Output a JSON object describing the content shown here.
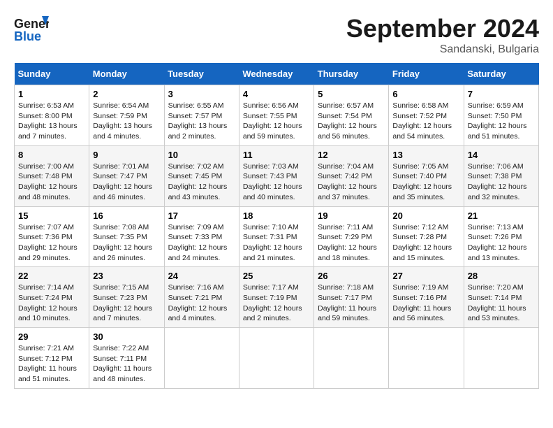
{
  "header": {
    "logo_general": "General",
    "logo_blue": "Blue",
    "month_title": "September 2024",
    "location": "Sandanski, Bulgaria"
  },
  "days_of_week": [
    "Sunday",
    "Monday",
    "Tuesday",
    "Wednesday",
    "Thursday",
    "Friday",
    "Saturday"
  ],
  "weeks": [
    [
      {
        "day": "1",
        "sunrise": "Sunrise: 6:53 AM",
        "sunset": "Sunset: 8:00 PM",
        "daylight": "Daylight: 13 hours and 7 minutes."
      },
      {
        "day": "2",
        "sunrise": "Sunrise: 6:54 AM",
        "sunset": "Sunset: 7:59 PM",
        "daylight": "Daylight: 13 hours and 4 minutes."
      },
      {
        "day": "3",
        "sunrise": "Sunrise: 6:55 AM",
        "sunset": "Sunset: 7:57 PM",
        "daylight": "Daylight: 13 hours and 2 minutes."
      },
      {
        "day": "4",
        "sunrise": "Sunrise: 6:56 AM",
        "sunset": "Sunset: 7:55 PM",
        "daylight": "Daylight: 12 hours and 59 minutes."
      },
      {
        "day": "5",
        "sunrise": "Sunrise: 6:57 AM",
        "sunset": "Sunset: 7:54 PM",
        "daylight": "Daylight: 12 hours and 56 minutes."
      },
      {
        "day": "6",
        "sunrise": "Sunrise: 6:58 AM",
        "sunset": "Sunset: 7:52 PM",
        "daylight": "Daylight: 12 hours and 54 minutes."
      },
      {
        "day": "7",
        "sunrise": "Sunrise: 6:59 AM",
        "sunset": "Sunset: 7:50 PM",
        "daylight": "Daylight: 12 hours and 51 minutes."
      }
    ],
    [
      {
        "day": "8",
        "sunrise": "Sunrise: 7:00 AM",
        "sunset": "Sunset: 7:48 PM",
        "daylight": "Daylight: 12 hours and 48 minutes."
      },
      {
        "day": "9",
        "sunrise": "Sunrise: 7:01 AM",
        "sunset": "Sunset: 7:47 PM",
        "daylight": "Daylight: 12 hours and 46 minutes."
      },
      {
        "day": "10",
        "sunrise": "Sunrise: 7:02 AM",
        "sunset": "Sunset: 7:45 PM",
        "daylight": "Daylight: 12 hours and 43 minutes."
      },
      {
        "day": "11",
        "sunrise": "Sunrise: 7:03 AM",
        "sunset": "Sunset: 7:43 PM",
        "daylight": "Daylight: 12 hours and 40 minutes."
      },
      {
        "day": "12",
        "sunrise": "Sunrise: 7:04 AM",
        "sunset": "Sunset: 7:42 PM",
        "daylight": "Daylight: 12 hours and 37 minutes."
      },
      {
        "day": "13",
        "sunrise": "Sunrise: 7:05 AM",
        "sunset": "Sunset: 7:40 PM",
        "daylight": "Daylight: 12 hours and 35 minutes."
      },
      {
        "day": "14",
        "sunrise": "Sunrise: 7:06 AM",
        "sunset": "Sunset: 7:38 PM",
        "daylight": "Daylight: 12 hours and 32 minutes."
      }
    ],
    [
      {
        "day": "15",
        "sunrise": "Sunrise: 7:07 AM",
        "sunset": "Sunset: 7:36 PM",
        "daylight": "Daylight: 12 hours and 29 minutes."
      },
      {
        "day": "16",
        "sunrise": "Sunrise: 7:08 AM",
        "sunset": "Sunset: 7:35 PM",
        "daylight": "Daylight: 12 hours and 26 minutes."
      },
      {
        "day": "17",
        "sunrise": "Sunrise: 7:09 AM",
        "sunset": "Sunset: 7:33 PM",
        "daylight": "Daylight: 12 hours and 24 minutes."
      },
      {
        "day": "18",
        "sunrise": "Sunrise: 7:10 AM",
        "sunset": "Sunset: 7:31 PM",
        "daylight": "Daylight: 12 hours and 21 minutes."
      },
      {
        "day": "19",
        "sunrise": "Sunrise: 7:11 AM",
        "sunset": "Sunset: 7:29 PM",
        "daylight": "Daylight: 12 hours and 18 minutes."
      },
      {
        "day": "20",
        "sunrise": "Sunrise: 7:12 AM",
        "sunset": "Sunset: 7:28 PM",
        "daylight": "Daylight: 12 hours and 15 minutes."
      },
      {
        "day": "21",
        "sunrise": "Sunrise: 7:13 AM",
        "sunset": "Sunset: 7:26 PM",
        "daylight": "Daylight: 12 hours and 13 minutes."
      }
    ],
    [
      {
        "day": "22",
        "sunrise": "Sunrise: 7:14 AM",
        "sunset": "Sunset: 7:24 PM",
        "daylight": "Daylight: 12 hours and 10 minutes."
      },
      {
        "day": "23",
        "sunrise": "Sunrise: 7:15 AM",
        "sunset": "Sunset: 7:23 PM",
        "daylight": "Daylight: 12 hours and 7 minutes."
      },
      {
        "day": "24",
        "sunrise": "Sunrise: 7:16 AM",
        "sunset": "Sunset: 7:21 PM",
        "daylight": "Daylight: 12 hours and 4 minutes."
      },
      {
        "day": "25",
        "sunrise": "Sunrise: 7:17 AM",
        "sunset": "Sunset: 7:19 PM",
        "daylight": "Daylight: 12 hours and 2 minutes."
      },
      {
        "day": "26",
        "sunrise": "Sunrise: 7:18 AM",
        "sunset": "Sunset: 7:17 PM",
        "daylight": "Daylight: 11 hours and 59 minutes."
      },
      {
        "day": "27",
        "sunrise": "Sunrise: 7:19 AM",
        "sunset": "Sunset: 7:16 PM",
        "daylight": "Daylight: 11 hours and 56 minutes."
      },
      {
        "day": "28",
        "sunrise": "Sunrise: 7:20 AM",
        "sunset": "Sunset: 7:14 PM",
        "daylight": "Daylight: 11 hours and 53 minutes."
      }
    ],
    [
      {
        "day": "29",
        "sunrise": "Sunrise: 7:21 AM",
        "sunset": "Sunset: 7:12 PM",
        "daylight": "Daylight: 11 hours and 51 minutes."
      },
      {
        "day": "30",
        "sunrise": "Sunrise: 7:22 AM",
        "sunset": "Sunset: 7:11 PM",
        "daylight": "Daylight: 11 hours and 48 minutes."
      },
      {
        "day": "",
        "sunrise": "",
        "sunset": "",
        "daylight": ""
      },
      {
        "day": "",
        "sunrise": "",
        "sunset": "",
        "daylight": ""
      },
      {
        "day": "",
        "sunrise": "",
        "sunset": "",
        "daylight": ""
      },
      {
        "day": "",
        "sunrise": "",
        "sunset": "",
        "daylight": ""
      },
      {
        "day": "",
        "sunrise": "",
        "sunset": "",
        "daylight": ""
      }
    ]
  ]
}
